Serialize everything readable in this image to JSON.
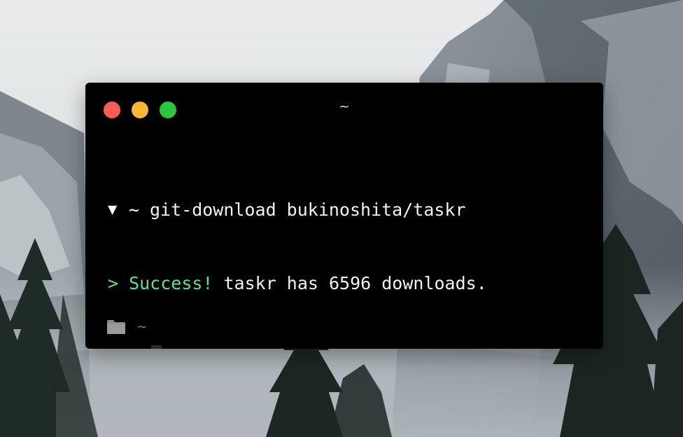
{
  "window": {
    "title": "~",
    "traffic_lights": {
      "close_color": "#fc5b57",
      "minimize_color": "#fcb731",
      "maximize_color": "#2ac73f"
    }
  },
  "terminal": {
    "lines": [
      {
        "prompt_symbol": "▼",
        "cwd": "~",
        "command": "git-download bukinoshita/taskr"
      },
      {
        "marker": ">",
        "status_word": "Success!",
        "message": "taskr has 6596 downloads."
      },
      {
        "prompt_symbol": "▼",
        "cwd": "~",
        "command": ""
      }
    ],
    "colors": {
      "background": "#000000",
      "text": "#f2f2f2",
      "success": "#5fe38c"
    }
  },
  "statusbar": {
    "icon": "folder-icon",
    "path": "~"
  }
}
